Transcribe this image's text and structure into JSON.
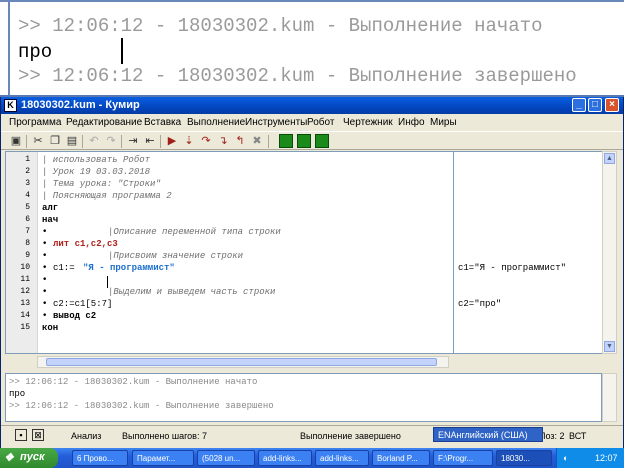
{
  "zoom_console": {
    "line1": ">> 12:06:12 - 18030302.kum - Выполнение начато",
    "line2": "про",
    "line3": ">> 12:06:12 - 18030302.kum - Выполнение завершено"
  },
  "window": {
    "title": "18030302.kum - Кумир",
    "icon_label": "K"
  },
  "menu": [
    "Программа",
    "Редактирование",
    "Вставка",
    "Выполнение",
    "Инструменты",
    "Робот",
    "Чертежник",
    "Инфо",
    "Миры"
  ],
  "editor": {
    "line_numbers": [
      "1",
      "2",
      "3",
      "4",
      "5",
      "6",
      "7",
      "8",
      "9",
      "10",
      "11",
      "12",
      "13",
      "14",
      "15"
    ],
    "lines": [
      "| использовать Робот",
      "| Урок 19 03.03.2018",
      "| Тема урока: \"Строки\"",
      "| Поясняющая программа  2",
      "алг",
      "нач",
      "|Описание переменной типа строки",
      "лит c1,c2,c3",
      "|Присвоим значение строки",
      "c1:=",
      "\"Я - программист\"",
      "|Выделим и выведем часть строки",
      "c2:=c1[5:7]",
      "вывод c2",
      "кон"
    ]
  },
  "margin": {
    "line10": "c1=\"Я - программист\"",
    "line13": "c2=\"про\""
  },
  "console": {
    "line1": ">> 12:06:12 - 18030302.kum - Выполнение начато",
    "line2": "про",
    "line3": ">> 12:06:12 - 18030302.kum - Выполнение завершено"
  },
  "status": {
    "mode": "Анализ",
    "steps": "Выполнено шагов: 7",
    "state": "Выполнение завершено",
    "position": "Стр: 11, Поз: 2",
    "ins": "ВСТ"
  },
  "language_bar": "ENАнглийский (США)",
  "taskbar": {
    "start": "пуск",
    "buttons": [
      "6 Прово...",
      "Парамет...",
      "(5028 un...",
      "add-links...",
      "add-links...",
      "Borland P...",
      "F:\\Progr...",
      "18030..."
    ],
    "clock": "12:07"
  }
}
